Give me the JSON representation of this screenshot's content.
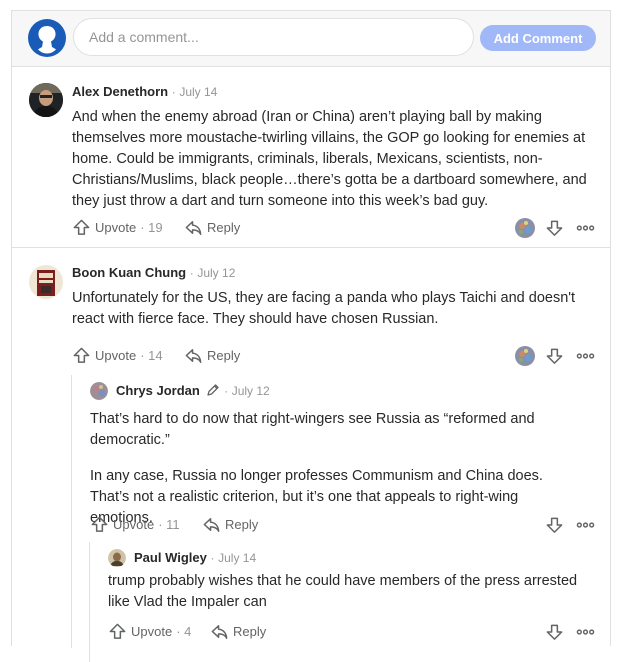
{
  "composer": {
    "input_placeholder": "Add a comment...",
    "add_button_label": "Add Comment"
  },
  "comments": [
    {
      "author": "Alex Denethorn",
      "separator": "·",
      "date": "July 14",
      "text": "And when the enemy abroad (Iran or China) aren’t playing ball by making themselves more moustache-twirling villains, the GOP go looking for enemies at home. Could be immigrants, criminals, liberals, Mexicans, scientists, non-Christians/Muslims, black people…there’s gotta be a dartboard somewhere, and they just throw a dart and turn someone into this week’s bad guy.",
      "upvote_label": "Upvote",
      "upvote_count": "· 19",
      "reply_label": "Reply"
    },
    {
      "author": "Boon Kuan Chung",
      "separator": "·",
      "date": "July 12",
      "text": "Unfortunately for the US, they are facing a panda who plays Taichi and doesn't react with fierce face. They should have chosen Russian.",
      "upvote_label": "Upvote",
      "upvote_count": "· 14",
      "reply_label": "Reply"
    },
    {
      "author": "Chrys Jordan",
      "separator": "·",
      "date": "July 12",
      "text_paragraphs": [
        "That’s hard to do now that right-wingers see Russia as “reformed and democratic.”",
        "In any case, Russia no longer professes Communism and China does. That’s not a realistic criterion, but it’s one that appeals to right-wing emotions."
      ],
      "upvote_label": "Upvote",
      "upvote_count": "· 11",
      "reply_label": "Reply"
    },
    {
      "author": "Paul Wigley",
      "separator": "·",
      "date": "July 14",
      "text": "trump probably wishes that he could have members of the press arrested like Vlad the Impaler can",
      "upvote_label": "Upvote",
      "upvote_count": "· 4",
      "reply_label": "Reply"
    }
  ],
  "icons": {
    "composer_avatar": "default-user-icon",
    "upvote": "upvote-arrow-icon",
    "reply": "reply-arrow-icon",
    "downvote": "downvote-arrow-icon",
    "more": "more-options-icon",
    "edit": "pencil-icon",
    "upvoter": "upvoter-avatar"
  },
  "colors": {
    "accent_button": "#a1b8f8",
    "default_avatar": "#1a5bb8",
    "text": "#282829",
    "muted": "#939598",
    "border": "#dee0e1"
  }
}
